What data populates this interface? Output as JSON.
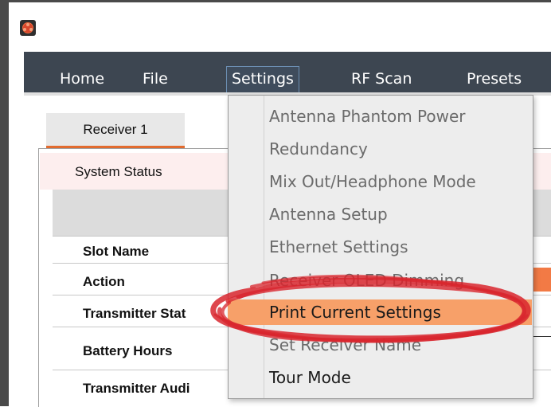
{
  "app": {
    "icon": "app-logo-icon"
  },
  "menubar": {
    "items": [
      {
        "label": "Home"
      },
      {
        "label": "File"
      },
      {
        "label": "Settings"
      },
      {
        "label": "RF Scan"
      },
      {
        "label": "Presets"
      }
    ]
  },
  "tabs": [
    {
      "label": "Receiver 1"
    }
  ],
  "panel": {
    "title": "System Status",
    "rows": [
      {
        "label": "Slot Name"
      },
      {
        "label": "Action"
      },
      {
        "label": "Transmitter Stat"
      },
      {
        "label": "Battery Hours"
      },
      {
        "label": "Transmitter Audi"
      }
    ]
  },
  "settings_menu": {
    "items": [
      {
        "label": "Antenna Phantom Power",
        "enabled": false
      },
      {
        "label": "Redundancy",
        "enabled": false
      },
      {
        "label": "Mix Out/Headphone Mode",
        "enabled": false
      },
      {
        "label": "Antenna Setup",
        "enabled": false
      },
      {
        "label": "Ethernet Settings",
        "enabled": false
      },
      {
        "label": "Receiver OLED Dimming",
        "enabled": false
      },
      {
        "label": "Print Current Settings",
        "enabled": true,
        "highlighted": true
      },
      {
        "label": "Set Receiver Name",
        "enabled": false
      },
      {
        "label": "Tour Mode",
        "enabled": true
      }
    ]
  },
  "colors": {
    "menubar_bg": "#3d4651",
    "accent_orange": "#e26b2f",
    "highlight": "#f7a069",
    "annotation_red": "#d8262e"
  }
}
